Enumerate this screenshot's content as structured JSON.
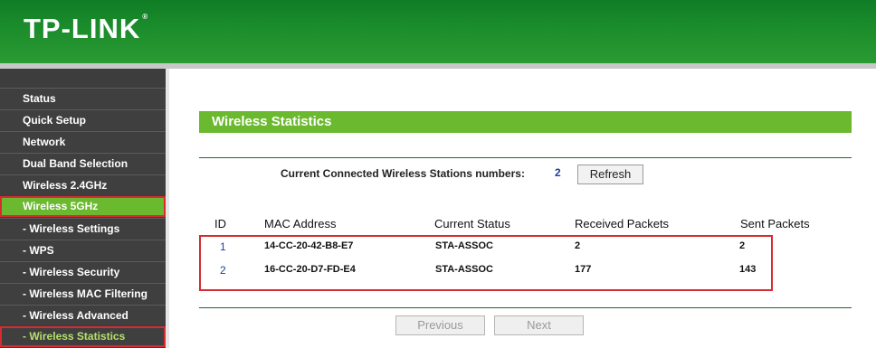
{
  "header": {
    "logo_text": "TP-LINK",
    "logo_mark": "®"
  },
  "sidebar": {
    "items": [
      {
        "label": "Status"
      },
      {
        "label": "Quick Setup"
      },
      {
        "label": "Network"
      },
      {
        "label": "Dual Band Selection"
      },
      {
        "label": "Wireless 2.4GHz"
      },
      {
        "label": "Wireless 5GHz"
      },
      {
        "label": "- Wireless Settings"
      },
      {
        "label": "- WPS"
      },
      {
        "label": "- Wireless Security"
      },
      {
        "label": "- Wireless MAC Filtering"
      },
      {
        "label": "- Wireless Advanced"
      },
      {
        "label": "- Wireless Statistics"
      }
    ]
  },
  "main": {
    "title": "Wireless Statistics",
    "stations_label": "Current Connected Wireless Stations numbers:",
    "stations_count": "2",
    "refresh_label": "Refresh",
    "table": {
      "headers": [
        "ID",
        "MAC Address",
        "Current Status",
        "Received Packets",
        "Sent Packets"
      ],
      "rows": [
        [
          "1",
          "14-CC-20-42-B8-E7",
          "STA-ASSOC",
          "2",
          "2"
        ],
        [
          "2",
          "16-CC-20-D7-FD-E4",
          "STA-ASSOC",
          "177",
          "143"
        ]
      ]
    },
    "previous_label": "Previous",
    "next_label": "Next"
  },
  "colors": {
    "header_green": "#1c8d2c",
    "accent_green": "#6ab92e",
    "highlight_red": "#d62b30",
    "sidebar_bg": "#3f3f3f"
  }
}
